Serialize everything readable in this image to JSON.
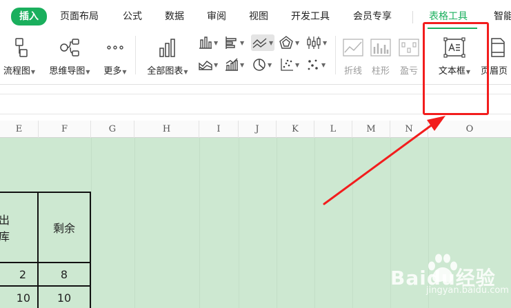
{
  "menu": {
    "tabs": [
      {
        "label": "插入",
        "active": true
      },
      {
        "label": "页面布局"
      },
      {
        "label": "公式"
      },
      {
        "label": "数据"
      },
      {
        "label": "审阅"
      },
      {
        "label": "视图"
      },
      {
        "label": "开发工具"
      },
      {
        "label": "会员专享"
      },
      {
        "label": "表格工具",
        "context": true
      },
      {
        "label": "智能"
      }
    ]
  },
  "ribbon": {
    "flowchart_label": "流程图",
    "mindmap_label": "思维导图",
    "more_label": "更多",
    "all_charts_label": "全部图表",
    "sparkline_line_label": "折线",
    "sparkline_column_label": "柱形",
    "sparkline_winloss_label": "盈亏",
    "textbox_label": "文本框",
    "header_footer_label": "页眉页"
  },
  "columns": [
    "E",
    "F",
    "G",
    "H",
    "I",
    "J",
    "K",
    "L",
    "M",
    "N",
    "O"
  ],
  "table": {
    "headers": [
      "出库",
      "剩余"
    ],
    "rows": [
      [
        "2",
        "8"
      ],
      [
        "10",
        "10"
      ]
    ]
  },
  "watermark": {
    "brand": "Baidu经验",
    "url": "jingyan.baidu.com"
  },
  "colors": {
    "accent": "#1aaf5d",
    "sheet_bg": "#cde8d1",
    "highlight": "#f21d1d"
  }
}
